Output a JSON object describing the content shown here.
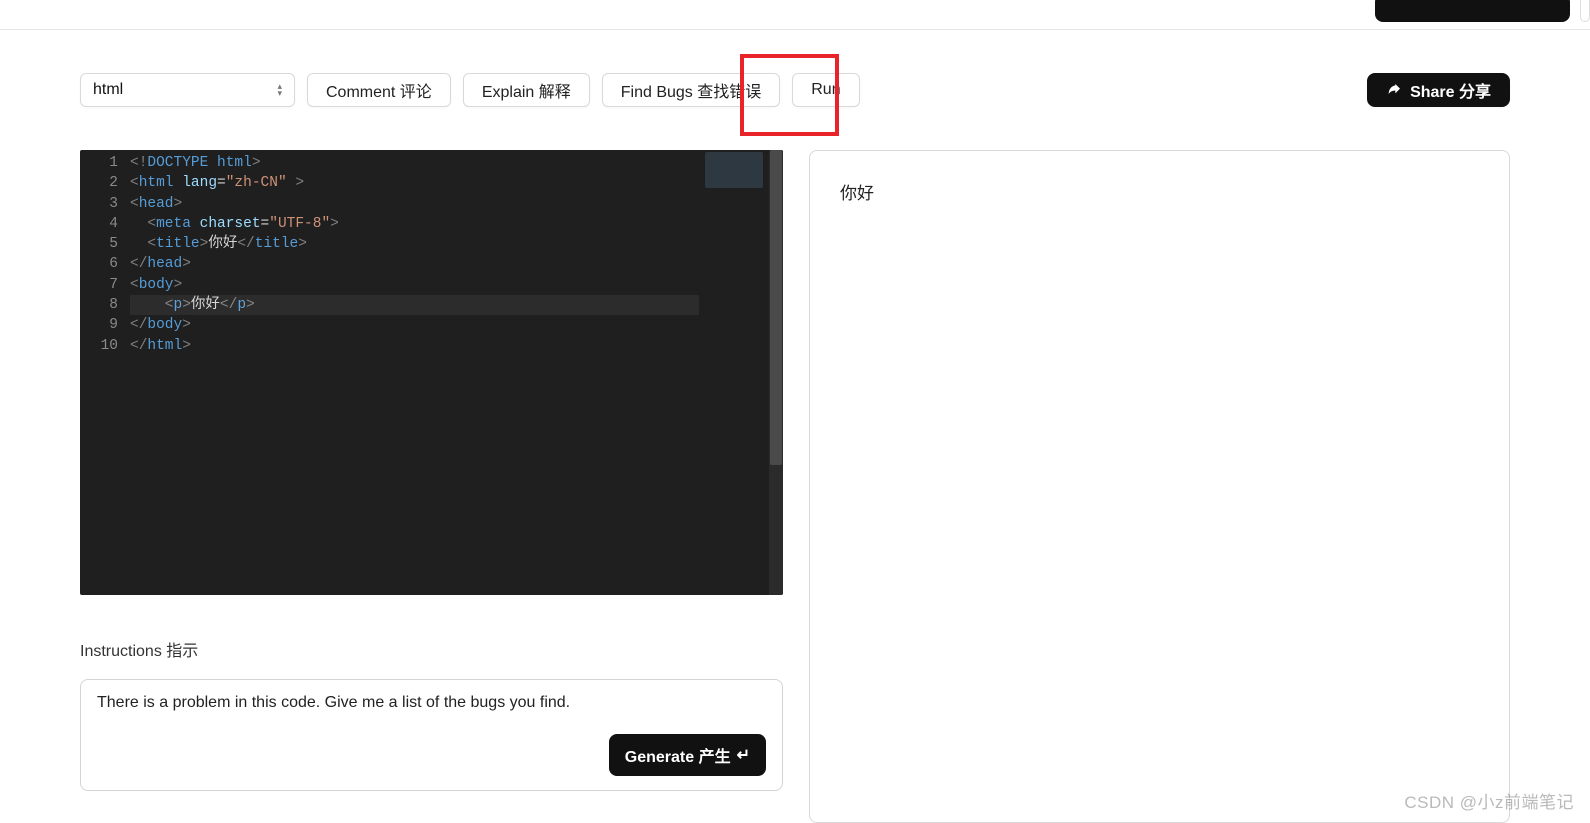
{
  "toolbar": {
    "language": "html",
    "comment": "Comment 评论",
    "explain": "Explain 解释",
    "findbugs": "Find Bugs 查找错误",
    "run": "Run",
    "share": "Share 分享"
  },
  "editor": {
    "lines": [
      [
        {
          "t": "<!",
          "c": "c-brkt"
        },
        {
          "t": "DOCTYPE",
          "c": "c-doc"
        },
        {
          "t": " ",
          "c": "c-txt"
        },
        {
          "t": "html",
          "c": "c-doc"
        },
        {
          "t": ">",
          "c": "c-brkt"
        }
      ],
      [
        {
          "t": "<",
          "c": "c-brkt"
        },
        {
          "t": "html",
          "c": "c-tag"
        },
        {
          "t": " ",
          "c": "c-txt"
        },
        {
          "t": "lang",
          "c": "c-attr"
        },
        {
          "t": "=",
          "c": "c-txt"
        },
        {
          "t": "\"zh-CN\"",
          "c": "c-str"
        },
        {
          "t": " >",
          "c": "c-brkt"
        }
      ],
      [
        {
          "t": "<",
          "c": "c-brkt"
        },
        {
          "t": "head",
          "c": "c-tag"
        },
        {
          "t": ">",
          "c": "c-brkt"
        }
      ],
      [
        {
          "t": "  <",
          "c": "c-brkt"
        },
        {
          "t": "meta",
          "c": "c-tag"
        },
        {
          "t": " ",
          "c": "c-txt"
        },
        {
          "t": "charset",
          "c": "c-attr"
        },
        {
          "t": "=",
          "c": "c-txt"
        },
        {
          "t": "\"UTF-8\"",
          "c": "c-str"
        },
        {
          "t": ">",
          "c": "c-brkt"
        }
      ],
      [
        {
          "t": "  <",
          "c": "c-brkt"
        },
        {
          "t": "title",
          "c": "c-tag"
        },
        {
          "t": ">",
          "c": "c-brkt"
        },
        {
          "t": "你好",
          "c": "c-txt"
        },
        {
          "t": "</",
          "c": "c-brkt"
        },
        {
          "t": "title",
          "c": "c-tag"
        },
        {
          "t": ">",
          "c": "c-brkt"
        }
      ],
      [
        {
          "t": "</",
          "c": "c-brkt"
        },
        {
          "t": "head",
          "c": "c-tag"
        },
        {
          "t": ">",
          "c": "c-brkt"
        }
      ],
      [
        {
          "t": "<",
          "c": "c-brkt"
        },
        {
          "t": "body",
          "c": "c-tag"
        },
        {
          "t": ">",
          "c": "c-brkt"
        }
      ],
      [
        {
          "t": "    <",
          "c": "c-brkt"
        },
        {
          "t": "p",
          "c": "c-tag"
        },
        {
          "t": ">",
          "c": "c-brkt"
        },
        {
          "t": "你好",
          "c": "c-txt"
        },
        {
          "t": "</",
          "c": "c-brkt"
        },
        {
          "t": "p",
          "c": "c-tag"
        },
        {
          "t": ">",
          "c": "c-brkt"
        }
      ],
      [
        {
          "t": "</",
          "c": "c-brkt"
        },
        {
          "t": "body",
          "c": "c-tag"
        },
        {
          "t": ">",
          "c": "c-brkt"
        }
      ],
      [
        {
          "t": "</",
          "c": "c-brkt"
        },
        {
          "t": "html",
          "c": "c-tag"
        },
        {
          "t": ">",
          "c": "c-brkt"
        }
      ]
    ]
  },
  "instructions": {
    "label": "Instructions 指示",
    "value": "There is a problem in this code. Give me a list of the bugs you find.",
    "generate": "Generate  产生"
  },
  "preview": {
    "output": "你好"
  },
  "watermark": "CSDN @小z前端笔记"
}
